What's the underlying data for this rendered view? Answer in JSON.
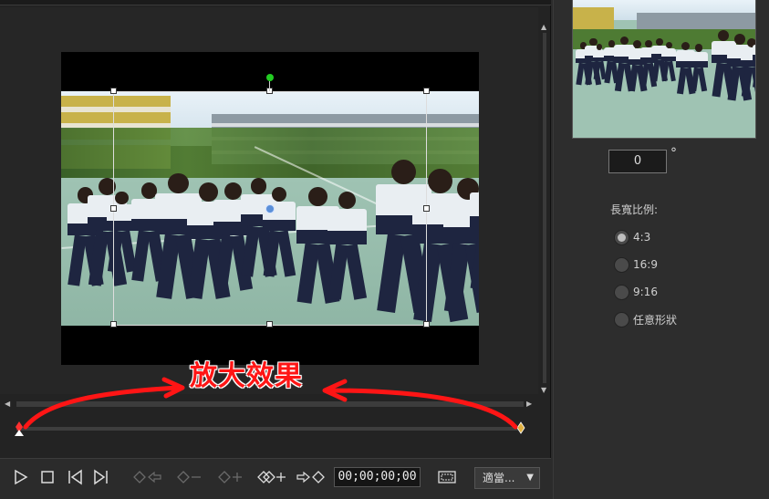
{
  "preview": {
    "annotation_text": "放大效果"
  },
  "controls": {
    "timecode": "00;00;00;00",
    "fit_select": "適當...",
    "fit_caret": "▼"
  },
  "settings": {
    "angle_value": "0",
    "angle_unit": "°",
    "ratio_label": "長寬比例:",
    "ratio_options": [
      {
        "label": "4:3",
        "checked": true
      },
      {
        "label": "16:9",
        "checked": false
      },
      {
        "label": "9:16",
        "checked": false
      },
      {
        "label": "任意形狀",
        "checked": false
      }
    ]
  },
  "icons": {
    "play": "play-icon",
    "stop": "stop-icon",
    "prev_frame": "previous-frame-icon",
    "next_frame": "next-frame-icon",
    "prev_keyframe": "previous-keyframe-icon",
    "remove_keyframe": "remove-keyframe-icon",
    "add_keyframe": "add-keyframe-icon",
    "duplicate_prev_keyframe": "duplicate-previous-keyframe-icon",
    "duplicate_next_keyframe": "duplicate-next-keyframe-icon",
    "safe_zone": "safe-zone-icon"
  },
  "colors": {
    "annotation": "#ff1515",
    "rotation_handle": "#22cc22",
    "center_handle": "#5b8fd8",
    "start_keyframe": "#ff3030",
    "end_keyframe": "#e0b040"
  }
}
